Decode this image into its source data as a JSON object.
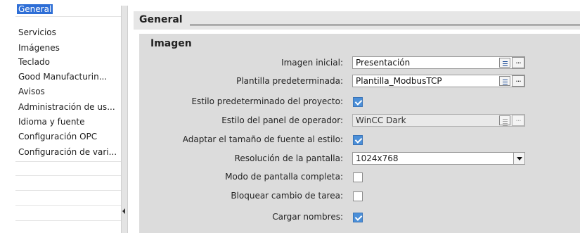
{
  "nav": {
    "items": [
      {
        "label": "General",
        "selected": true
      },
      {
        "label": "Servicios"
      },
      {
        "label": "Imágenes"
      },
      {
        "label": "Teclado"
      },
      {
        "label": "Good Manufacturin..."
      },
      {
        "label": "Avisos"
      },
      {
        "label": "Administración de us..."
      },
      {
        "label": "Idioma y fuente"
      },
      {
        "label": "Configuración OPC"
      },
      {
        "label": "Configuración de vari..."
      }
    ]
  },
  "section": {
    "title": "General"
  },
  "panel": {
    "title": "Imagen",
    "fields": {
      "initial_screen": {
        "label": "Imagen inicial:",
        "value": "Presentación"
      },
      "default_template": {
        "label": "Plantilla predeterminada:",
        "value": "Plantilla_ModbusTCP"
      },
      "project_default_style": {
        "label": "Estilo predeterminado del proyecto:",
        "checked": true
      },
      "operator_panel_style": {
        "label": "Estilo del panel de operador:",
        "value": "WinCC Dark",
        "disabled": true
      },
      "adapt_font_size": {
        "label": "Adaptar el tamaño de fuente al estilo:",
        "checked": true
      },
      "screen_resolution": {
        "label": "Resolución de la pantalla:",
        "value": "1024x768"
      },
      "fullscreen_mode": {
        "label": "Modo de pantalla completa:",
        "checked": false
      },
      "lock_task_switch": {
        "label": "Bloquear cambio de tarea:",
        "checked": false
      },
      "load_names": {
        "label": "Cargar nombres:",
        "checked": true
      }
    }
  },
  "buttons": {
    "dots": "..."
  }
}
